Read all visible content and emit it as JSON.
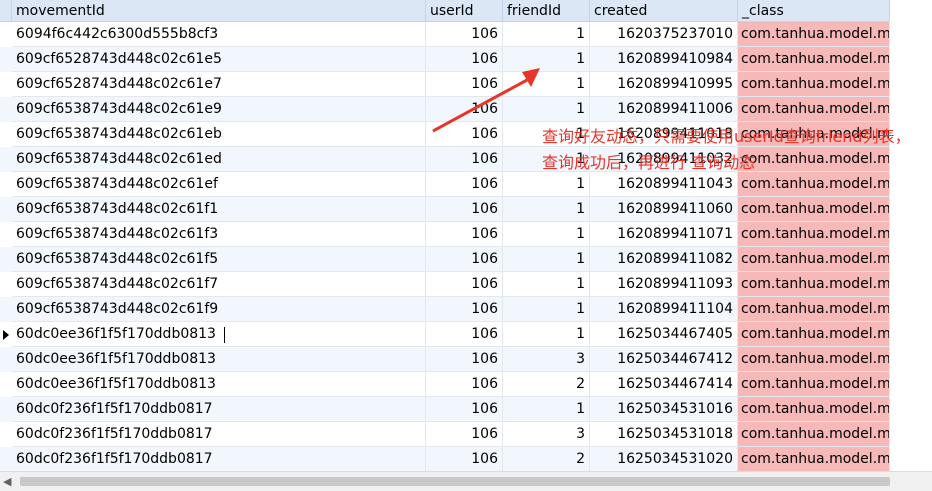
{
  "table": {
    "columns": [
      "movementId",
      "userId",
      "friendId",
      "created",
      "_class"
    ],
    "rows": [
      [
        "6094f6c442c6300d555b8cf3",
        "106",
        "1",
        "1620375237010",
        "com.tanhua.model.m"
      ],
      [
        "609cf6528743d448c02c61e5",
        "106",
        "1",
        "1620899410984",
        "com.tanhua.model.m"
      ],
      [
        "609cf6528743d448c02c61e7",
        "106",
        "1",
        "1620899410995",
        "com.tanhua.model.m"
      ],
      [
        "609cf6538743d448c02c61e9",
        "106",
        "1",
        "1620899411006",
        "com.tanhua.model.m"
      ],
      [
        "609cf6538743d448c02c61eb",
        "106",
        "1",
        "1620899411018",
        "com.tanhua.model.m"
      ],
      [
        "609cf6538743d448c02c61ed",
        "106",
        "1",
        "1620899411032",
        "com.tanhua.model.m"
      ],
      [
        "609cf6538743d448c02c61ef",
        "106",
        "1",
        "1620899411043",
        "com.tanhua.model.m"
      ],
      [
        "609cf6538743d448c02c61f1",
        "106",
        "1",
        "1620899411060",
        "com.tanhua.model.m"
      ],
      [
        "609cf6538743d448c02c61f3",
        "106",
        "1",
        "1620899411071",
        "com.tanhua.model.m"
      ],
      [
        "609cf6538743d448c02c61f5",
        "106",
        "1",
        "1620899411082",
        "com.tanhua.model.m"
      ],
      [
        "609cf6538743d448c02c61f7",
        "106",
        "1",
        "1620899411093",
        "com.tanhua.model.m"
      ],
      [
        "609cf6538743d448c02c61f9",
        "106",
        "1",
        "1620899411104",
        "com.tanhua.model.m"
      ],
      [
        "60dc0ee36f1f5f170ddb0813",
        "106",
        "1",
        "1625034467405",
        "com.tanhua.model.m"
      ],
      [
        "60dc0ee36f1f5f170ddb0813",
        "106",
        "3",
        "1625034467412",
        "com.tanhua.model.m"
      ],
      [
        "60dc0ee36f1f5f170ddb0813",
        "106",
        "2",
        "1625034467414",
        "com.tanhua.model.m"
      ],
      [
        "60dc0f236f1f5f170ddb0817",
        "106",
        "1",
        "1625034531016",
        "com.tanhua.model.m"
      ],
      [
        "60dc0f236f1f5f170ddb0817",
        "106",
        "3",
        "1625034531018",
        "com.tanhua.model.m"
      ],
      [
        "60dc0f236f1f5f170ddb0817",
        "106",
        "2",
        "1625034531020",
        "com.tanhua.model.m"
      ]
    ],
    "current_row": 12,
    "class_cell_color": "#f7b8b8",
    "header_color": "#dbe7f5"
  },
  "annotation": {
    "text": "查询好友动态，只需要使用userId查询friend列表，查询成功后，再进行 查询动态",
    "color": "#e8352a"
  },
  "scrollbar": {
    "left_arrow_icon": "scroll-left-arrow-icon"
  }
}
